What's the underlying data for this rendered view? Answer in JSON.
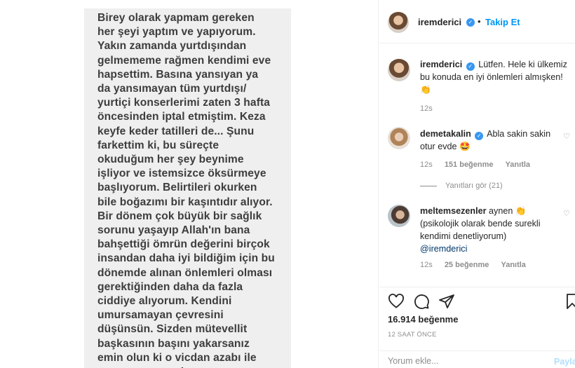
{
  "story": {
    "text": "Birey olarak yapmam gereken\nher şeyi yaptım ve yapıyorum.\nYakın zamanda yurtdışından\ngelmememe rağmen kendimi eve\nhapsettim. Basına yansıyan ya\nda yansımayan tüm yurtdışı/\nyurtiçi konserlerimi zaten 3 hafta\nöncesinden iptal etmiştim. Keza\nkeyfe keder tatilleri de... Şunu\nfarkettim ki, bu süreçte\nokuduğum her şey beynime\nişliyor ve istemsizce öksürmeye\nbaşlıyorum. Belirtileri okurken\nbile boğazımı bir kaşıntıdır alıyor.\nBir dönem çok büyük bir sağlık\nsorunu yaşayıp Allah'ın bana\nbahşettiği ömrün değerini birçok\ninsandan daha iyi bildiğim için bu\ndönemde alınan önlemleri olması\ngerektiğinden daha da fazla\nciddiye alıyorum. Kendini\numursamayan çevresini\ndüşünsün. Sizden mütevellit\nbaşkasının başını yakarsanız\nemin olun ki o vicdan azabı ile\nyaşayamazsınız!"
  },
  "header": {
    "username": "iremderici",
    "separator": "•",
    "follow_label": "Takip Et"
  },
  "caption": {
    "username": "iremderici",
    "text": "Lütfen. Hele ki ülkemiz bu konuda en iyi önlemleri almışken!",
    "emoji": "👏",
    "time": "12s"
  },
  "comments": [
    {
      "username": "demetakalin",
      "text": "Abla sakin sakin otur evde",
      "emoji": "🤩",
      "time": "12s",
      "likes": "151 beğenme",
      "reply": "Yanıtla",
      "view_replies": "Yanıtları gör (21)"
    },
    {
      "username": "meltemsezenler",
      "text": "aynen",
      "emoji": "👏",
      "text2": "(psikolojik olarak bende surekli kendimi denetliyorum)",
      "mention": "@iremderici",
      "time": "12s",
      "likes": "25 beğenme",
      "reply": "Yanıtla"
    }
  ],
  "footer": {
    "likes": "16.914 beğenme",
    "time_ago": "12 SAAT ÖNCE",
    "comment_placeholder": "Yorum ekle...",
    "post_label": "Payla"
  },
  "colors": {
    "accent": "#0095f6",
    "verified": "#3897f0",
    "muted": "#8e8e8e",
    "story_bg": "#efefef"
  }
}
